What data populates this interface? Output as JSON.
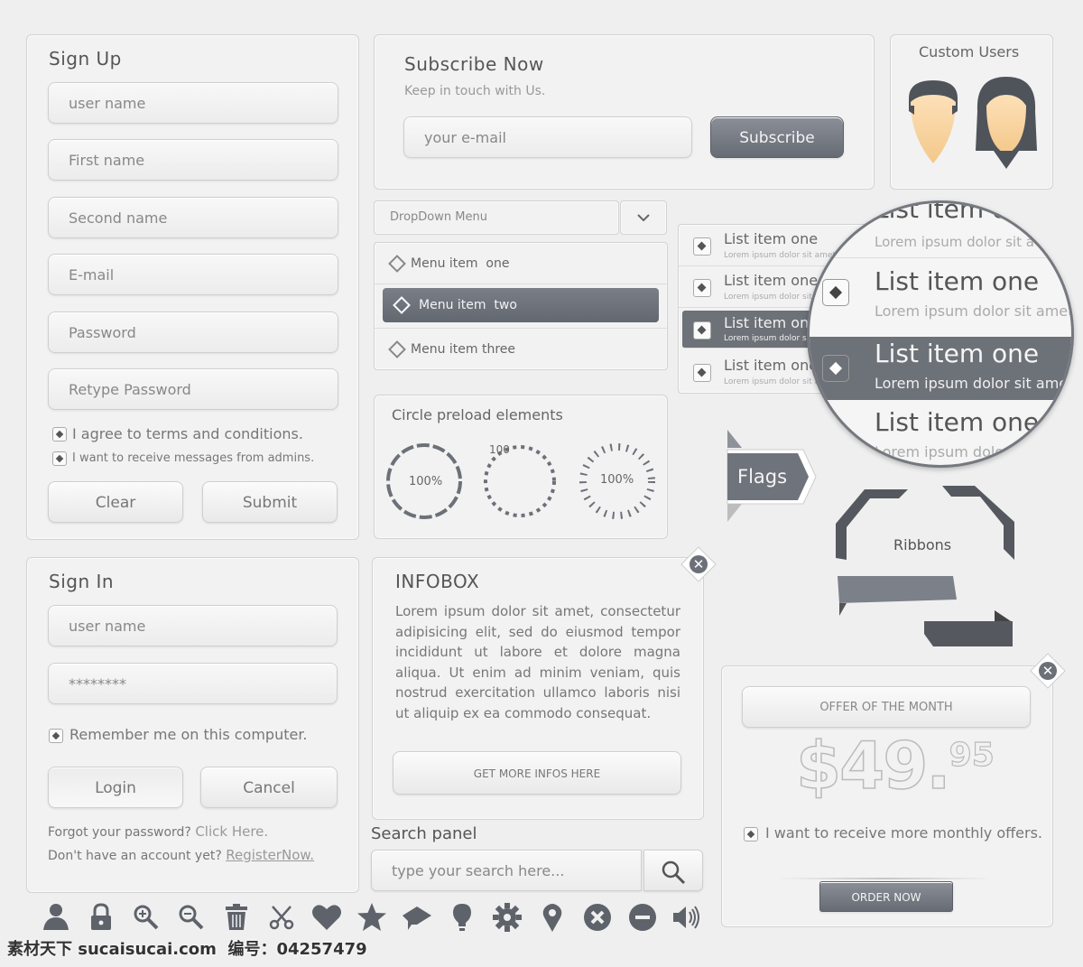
{
  "signup": {
    "title": "Sign Up",
    "fields": [
      "user name",
      "First name",
      "Second name",
      "E-mail",
      "Password",
      "Retype Password"
    ],
    "agree": "I agree to terms and conditions.",
    "messages": "I want to receive messages from admins.",
    "clear": "Clear",
    "submit": "Submit"
  },
  "subscribe": {
    "title": "Subscribe Now",
    "subtitle": "Keep in touch with Us.",
    "email_placeholder": "your e-mail",
    "button": "Subscribe"
  },
  "users": {
    "title": "Custom Users"
  },
  "dropdown": {
    "selected": "DropDown Menu",
    "items": [
      "Menu item  one",
      "Menu item  two",
      "Menu item three"
    ]
  },
  "list": {
    "title": "List item one",
    "subtitle": "Lorem ipsum dolor sit amet,",
    "magnified_top_title": "List item one",
    "magnified_top_sub": "Lorem ipsum dolor sit a",
    "magnified_sub_active": "Lorem ipsum dolor sit amet",
    "magnified_bottom_sub": "Lorem ipsum dolor"
  },
  "preload": {
    "title": "Circle preload elements",
    "labels": [
      "100%",
      "100",
      "100%"
    ]
  },
  "flags": {
    "label": "Flags"
  },
  "ribbons": {
    "label": "Ribbons"
  },
  "signin": {
    "title": "Sign In",
    "username_placeholder": "user name",
    "password_placeholder": "********",
    "remember": "Remember me on this computer.",
    "login": "Login",
    "cancel": "Cancel",
    "forgot": "Forgot your password?",
    "forgot_link": "Click Here.",
    "noaccount": "Don't have an account yet?",
    "register_link": "RegisterNow."
  },
  "infobox": {
    "title": "INFOBOX",
    "body": "Lorem ipsum dolor sit amet, consectetur adipisicing elit, sed do eiusmod tempor incididunt ut labore et dolore magna aliqua. Ut enim ad minim veniam, quis nostrud exercitation ullamco laboris nisi ut aliquip ex ea commodo consequat.",
    "button": "GET MORE INFOS HERE"
  },
  "search": {
    "title": "Search panel",
    "placeholder": "type your search here..."
  },
  "offer": {
    "title": "OFFER OF THE MONTH",
    "price": "$49.",
    "cents": "95",
    "checkbox": "I want to receive more monthly offers.",
    "button": "ORDER NOW"
  },
  "watermark": "素材天下 sucaisucai.com  编号：04257479",
  "icons": [
    "user-icon",
    "lock-icon",
    "zoom-in-icon",
    "zoom-out-icon",
    "trash-icon",
    "scissors-icon",
    "heart-icon",
    "star-icon",
    "comment-icon",
    "lightbulb-icon",
    "gear-icon",
    "map-pin-icon",
    "close-circle-icon",
    "minus-circle-icon",
    "speaker-icon"
  ]
}
